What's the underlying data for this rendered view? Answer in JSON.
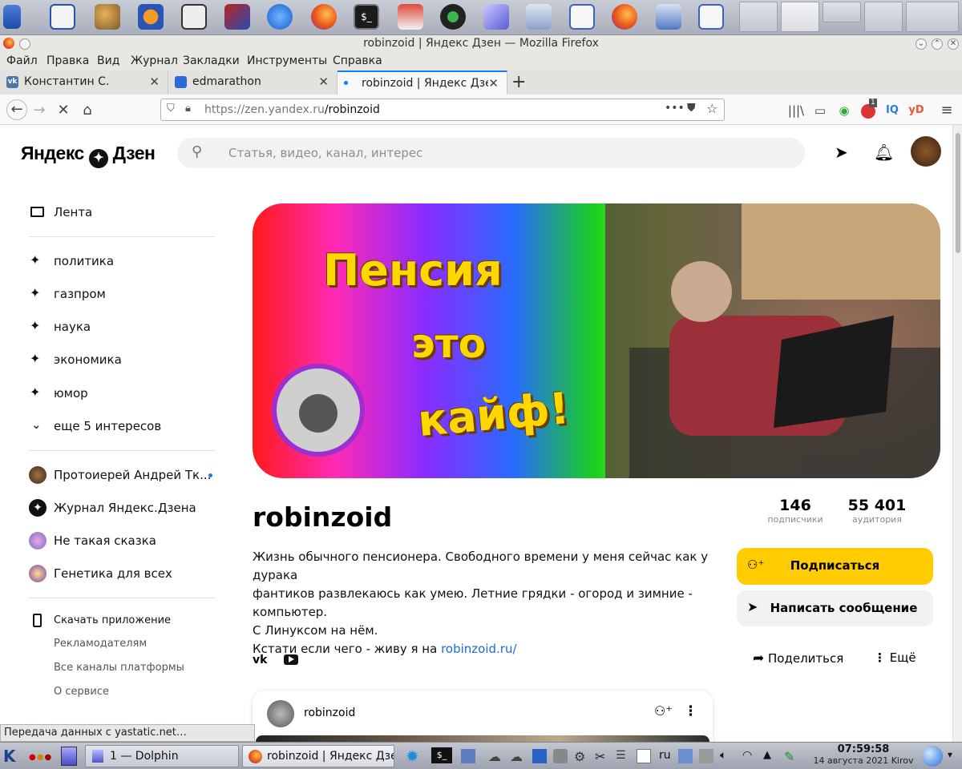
{
  "window": {
    "title": "robinzoid | Яндекс Дзен — Mozilla Firefox"
  },
  "menubar": [
    "Файл",
    "Правка",
    "Вид",
    "Журнал",
    "Закладки",
    "Инструменты",
    "Справка"
  ],
  "tabs": [
    {
      "label": "Константин С.",
      "favicon": "vk-icon",
      "active": false
    },
    {
      "label": "edmarathon",
      "favicon": "edmarathon-icon",
      "active": false
    },
    {
      "label": "robinzoid | Яндекс Дзен",
      "favicon": "loading-dot-icon",
      "active": true
    }
  ],
  "navbar": {
    "url_host": "https://zen.yandex.ru",
    "url_path": "/robinzoid",
    "ext_badge": "1",
    "ext_iq": "IQ",
    "ext_yd": "yD"
  },
  "header": {
    "logo_text": "Яндекс",
    "logo_text2": "Дзен",
    "search_placeholder": "Статья, видео, канал, интерес"
  },
  "sidebar": {
    "feed_label": "Лента",
    "interests": [
      "политика",
      "газпром",
      "наука",
      "экономика",
      "юмор"
    ],
    "more_interests": "еще 5 интересов",
    "channels": [
      {
        "label": "Протоиерей Андрей Тк...",
        "unread": true
      },
      {
        "label": "Журнал Яндекс.Дзена",
        "unread": false
      },
      {
        "label": "Не такая сказка",
        "unread": false
      },
      {
        "label": "Генетика для всех",
        "unread": false
      }
    ],
    "download_app": "Скачать приложение",
    "footer": [
      "Рекламодателям",
      "Все каналы платформы",
      "О сервисе"
    ]
  },
  "banner": {
    "line1": "Пенсия",
    "line2": "это",
    "line3": "кайф!"
  },
  "channel": {
    "name": "robinzoid",
    "subscribers_value": "146",
    "subscribers_label": "подписчики",
    "audience_value": "55 401",
    "audience_label": "аудитория",
    "about_lines": [
      "Жизнь обычного пенсионера. Свободного времени у меня сейчас как у дурака",
      "фантиков развлекаюсь как умею. Летние грядки - огород и зимние -",
      "компьютер.",
      "С Линуксом на нём."
    ],
    "about_last_prefix": "Кстати если чего - живу я на ",
    "about_link": "robinzoid.ru/",
    "subscribe_button": "Подписаться",
    "message_button": "Написать сообщение",
    "share_button": "Поделиться",
    "more_button": "Ещё"
  },
  "post": {
    "author": "robinzoid"
  },
  "statusbar": {
    "text": "Передача данных с yastatic.net…"
  },
  "taskbar": {
    "tasks": [
      {
        "label": "1 — Dolphin",
        "icon": "dolphin-icon"
      },
      {
        "label": "robinzoid | Яндекс Дзен",
        "icon": "firefox-icon"
      }
    ],
    "keyboard_layout": "ru",
    "clock_time": "07:59:58",
    "clock_date": "14 августа 2021 Kirov"
  },
  "colors": {
    "accent_yellow": "#ffcc00",
    "link_blue": "#1a6bd6",
    "tab_active_line": "#0a84ff"
  }
}
